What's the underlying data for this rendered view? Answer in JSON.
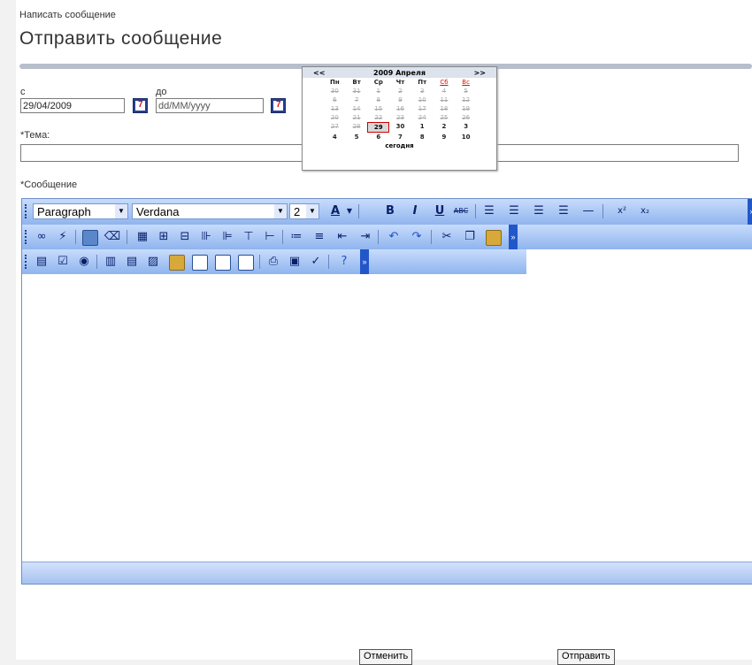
{
  "breadcrumb": "Написать сообщение",
  "page_title": "Отправить сообщение",
  "date_from": {
    "label": "с",
    "value": "29/04/2009"
  },
  "date_to": {
    "label": "до",
    "placeholder": "dd/MM/yyyy"
  },
  "subject": {
    "label": "*Тема:",
    "value": ""
  },
  "message": {
    "label": "*Сообщение"
  },
  "calendar": {
    "prev": "<<",
    "next": ">>",
    "month_title": "2009 Апреля",
    "weekdays": [
      "Пн",
      "Вт",
      "Ср",
      "Чт",
      "Пт",
      "Сб",
      "Вс"
    ],
    "weeks": [
      [
        "30",
        "31",
        "1",
        "2",
        "3",
        "4",
        "5"
      ],
      [
        "6",
        "7",
        "8",
        "9",
        "10",
        "11",
        "12"
      ],
      [
        "13",
        "14",
        "15",
        "16",
        "17",
        "18",
        "19"
      ],
      [
        "20",
        "21",
        "22",
        "23",
        "24",
        "25",
        "26"
      ],
      [
        "27",
        "28",
        "29",
        "30",
        "1",
        "2",
        "3"
      ],
      [
        "4",
        "5",
        "6",
        "7",
        "8",
        "9",
        "10"
      ]
    ],
    "selected": "29",
    "today_label": "сегодня"
  },
  "editor": {
    "block_format": "Paragraph",
    "font_name": "Verdana",
    "font_size": "2"
  },
  "buttons": {
    "cancel": "Отменить",
    "send": "Отправить"
  },
  "colors": {
    "toolbar_top": "#c8dcfc",
    "toolbar_bottom": "#8fb4ee",
    "selected_border": "#c00"
  }
}
